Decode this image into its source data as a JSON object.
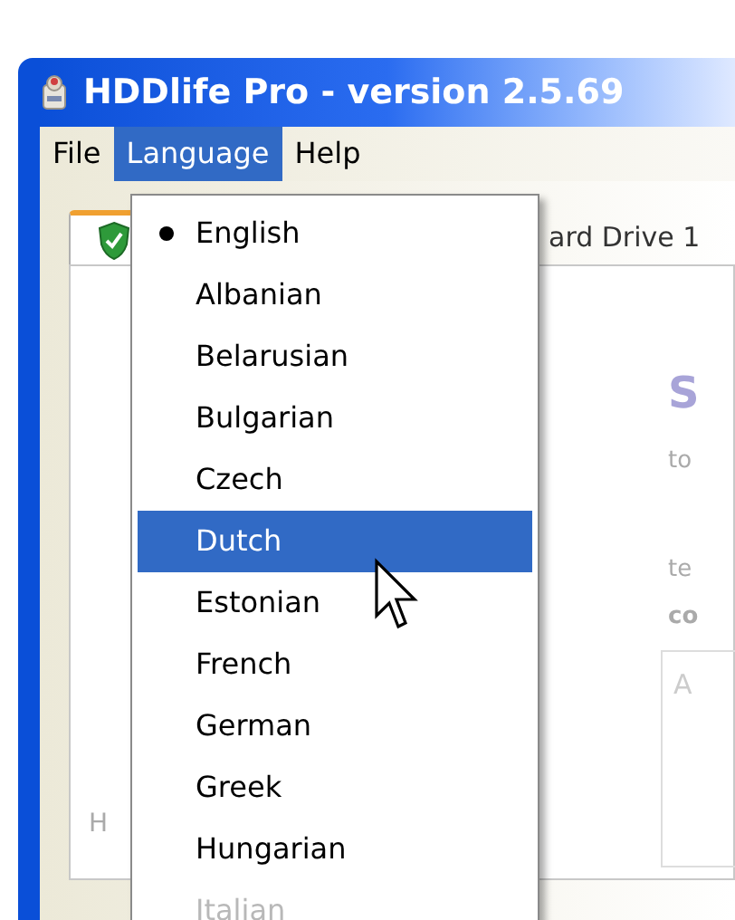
{
  "window": {
    "title": "HDDlife Pro - version 2.5.69"
  },
  "menu_bar": [
    {
      "label": "File",
      "selected": false
    },
    {
      "label": "Language",
      "selected": true
    },
    {
      "label": "Help",
      "selected": false
    }
  ],
  "tab": {
    "label": "ard Drive 1"
  },
  "content": {
    "heading": "S",
    "line_1": "to",
    "line_2": "te",
    "line_3": "co",
    "box_text": "A",
    "left_text": "H"
  },
  "language_menu": [
    {
      "label": "English",
      "checked": true,
      "selected": false,
      "disabled": false
    },
    {
      "label": "Albanian",
      "checked": false,
      "selected": false,
      "disabled": false
    },
    {
      "label": "Belarusian",
      "checked": false,
      "selected": false,
      "disabled": false
    },
    {
      "label": "Bulgarian",
      "checked": false,
      "selected": false,
      "disabled": false
    },
    {
      "label": "Czech",
      "checked": false,
      "selected": false,
      "disabled": false
    },
    {
      "label": "Dutch",
      "checked": false,
      "selected": true,
      "disabled": false
    },
    {
      "label": "Estonian",
      "checked": false,
      "selected": false,
      "disabled": false
    },
    {
      "label": "French",
      "checked": false,
      "selected": false,
      "disabled": false
    },
    {
      "label": "German",
      "checked": false,
      "selected": false,
      "disabled": false
    },
    {
      "label": "Greek",
      "checked": false,
      "selected": false,
      "disabled": false
    },
    {
      "label": "Hungarian",
      "checked": false,
      "selected": false,
      "disabled": false
    },
    {
      "label": "Italian",
      "checked": false,
      "selected": false,
      "disabled": true
    }
  ]
}
